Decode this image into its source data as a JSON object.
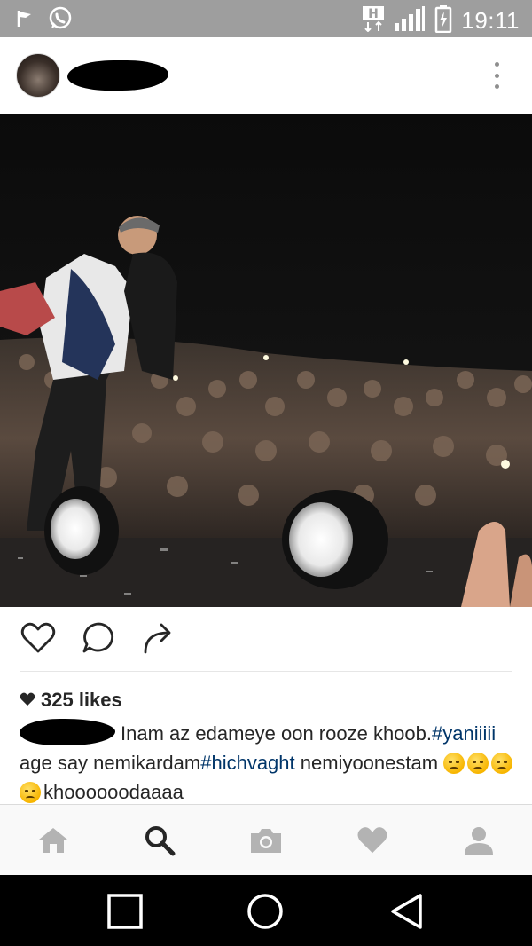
{
  "status_bar": {
    "time": "19:11",
    "network_type": "H",
    "icons": [
      "flag-icon",
      "whatsapp-icon",
      "network-h-icon",
      "signal-icon",
      "battery-charging-icon"
    ]
  },
  "post": {
    "more_icon": "more-vertical-icon",
    "actions": [
      "heart-outline-icon",
      "comment-icon",
      "share-icon"
    ],
    "likes_text": "325 likes",
    "caption": {
      "text_1": "Inam az edameye oon rooze khoob.",
      "tag_1": "#yaniiiii",
      "text_2": " age say nemikardam",
      "tag_2": "#hichvaght",
      "text_3": " nemiyoonestam ",
      "text_4": "khoooooodaaaa"
    }
  },
  "tab_bar": {
    "tabs": [
      "home-icon",
      "search-icon",
      "camera-icon",
      "heart-icon",
      "profile-icon"
    ],
    "active": "search-icon"
  },
  "android_nav": [
    "recents-icon",
    "home-circle-icon",
    "back-icon"
  ],
  "colors": {
    "status_bar": "#9e9e9e",
    "hashtag": "#003569",
    "tab_inactive": "#b3b3b3",
    "tab_active": "#262626"
  }
}
